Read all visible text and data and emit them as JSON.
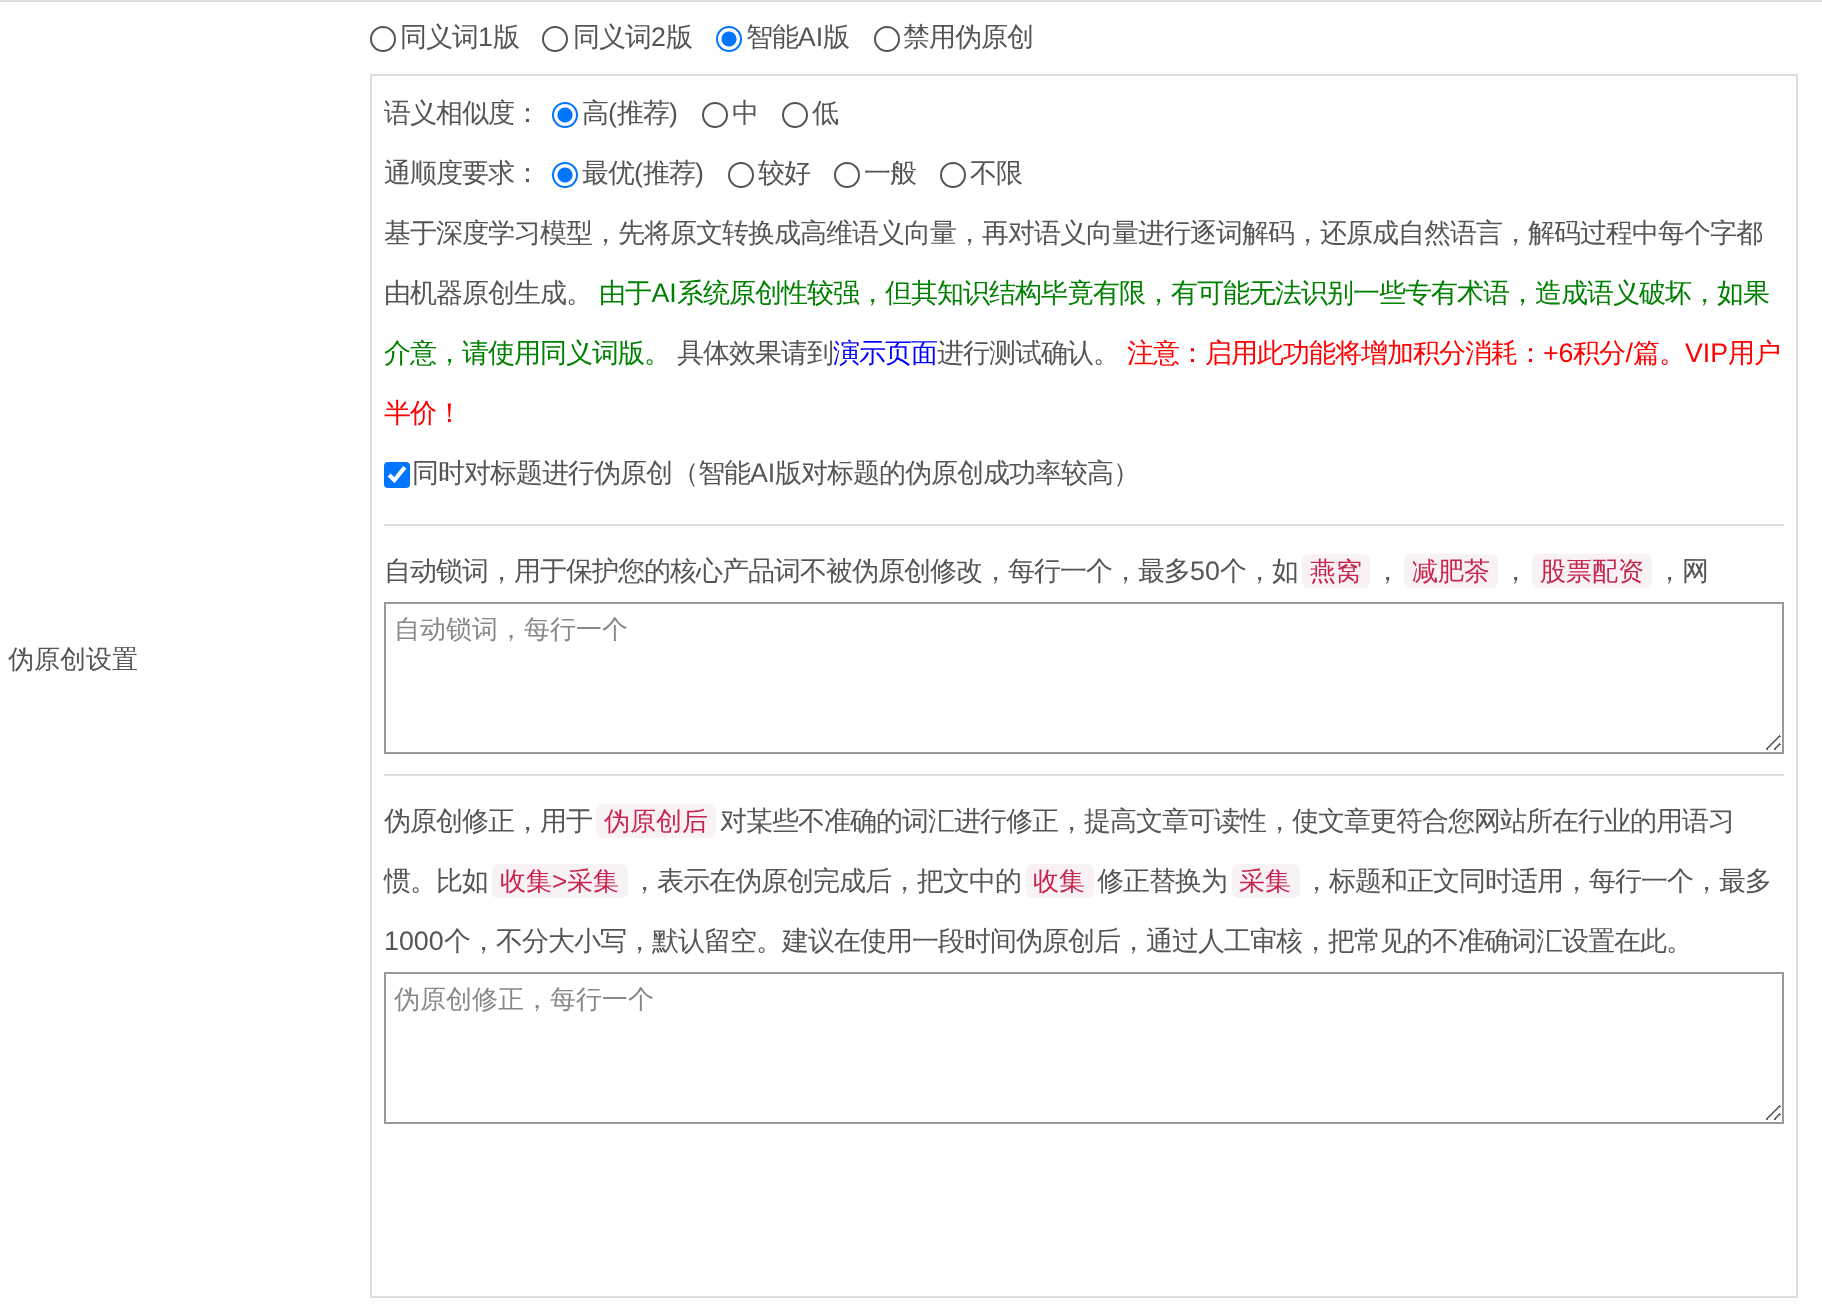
{
  "mode_options": [
    {
      "label": "同义词1版",
      "selected": false
    },
    {
      "label": "同义词2版",
      "selected": false
    },
    {
      "label": "智能AI版",
      "selected": true
    },
    {
      "label": "禁用伪原创",
      "selected": false
    }
  ],
  "semantic_similarity": {
    "label": "语义相似度：",
    "options": [
      {
        "label": "高(推荐)",
        "selected": true
      },
      {
        "label": "中",
        "selected": false
      },
      {
        "label": "低",
        "selected": false
      }
    ]
  },
  "fluency": {
    "label": "通顺度要求：",
    "options": [
      {
        "label": "最优(推荐)",
        "selected": true
      },
      {
        "label": "较好",
        "selected": false
      },
      {
        "label": "一般",
        "selected": false
      },
      {
        "label": "不限",
        "selected": false
      }
    ]
  },
  "ai_description": [
    {
      "kind": "text",
      "text": "基于深度学习模型，先将原文转换成高维语义向量，再对语义向量进行逐词解码，还原成自然语言，解码过程中每个字都由机器原创生成。 "
    },
    {
      "kind": "green",
      "text": "由于AI系统原创性较强，但其知识结构毕竟有限，有可能无法识别一些专有术语，造成语义破坏，如果介意，请使用同义词版。"
    },
    {
      "kind": "text",
      "text": " 具体效果请到"
    },
    {
      "kind": "link",
      "text": "演示页面"
    },
    {
      "kind": "text",
      "text": "进行测试确认。 "
    },
    {
      "kind": "red",
      "text": "注意：启用此功能将增加积分消耗：+6积分/篇。VIP用户半价！"
    }
  ],
  "title_checkbox": {
    "label": "同时对标题进行伪原创（智能AI版对标题的伪原创成功率较高）",
    "checked": true
  },
  "settings_label": "伪原创设置",
  "lock_words": {
    "description": [
      {
        "kind": "text",
        "text": "自动锁词，用于保护您的核心产品词不被伪原创修改，每行一个，最多50个，如"
      },
      {
        "kind": "tag",
        "text": "燕窝"
      },
      {
        "kind": "text",
        "text": "，"
      },
      {
        "kind": "tag",
        "text": "减肥茶"
      },
      {
        "kind": "text",
        "text": "，"
      },
      {
        "kind": "tag",
        "text": "股票配资"
      },
      {
        "kind": "text",
        "text": "，网"
      }
    ],
    "placeholder": "自动锁词，每行一个"
  },
  "correction": {
    "description": [
      {
        "kind": "text",
        "text": "伪原创修正，用于"
      },
      {
        "kind": "tag",
        "text": "伪原创后"
      },
      {
        "kind": "text",
        "text": "对某些不准确的词汇进行修正，提高文章可读性，使文章更符合您网站所在行业的用语习惯。比如"
      },
      {
        "kind": "tag",
        "text": "收集>采集"
      },
      {
        "kind": "text",
        "text": "，表示在伪原创完成后，把文中的"
      },
      {
        "kind": "tag",
        "text": "收集"
      },
      {
        "kind": "text",
        "text": "修正替换为"
      },
      {
        "kind": "tag",
        "text": "采集"
      },
      {
        "kind": "text",
        "text": "，标题和正文同时适用，每行一个，最多1000个，不分大小写，默认留空。建议在使用一段时间伪原创后，通过人工审核，把常见的不准确词汇设置在此。"
      }
    ],
    "placeholder": "伪原创修正，每行一个"
  }
}
